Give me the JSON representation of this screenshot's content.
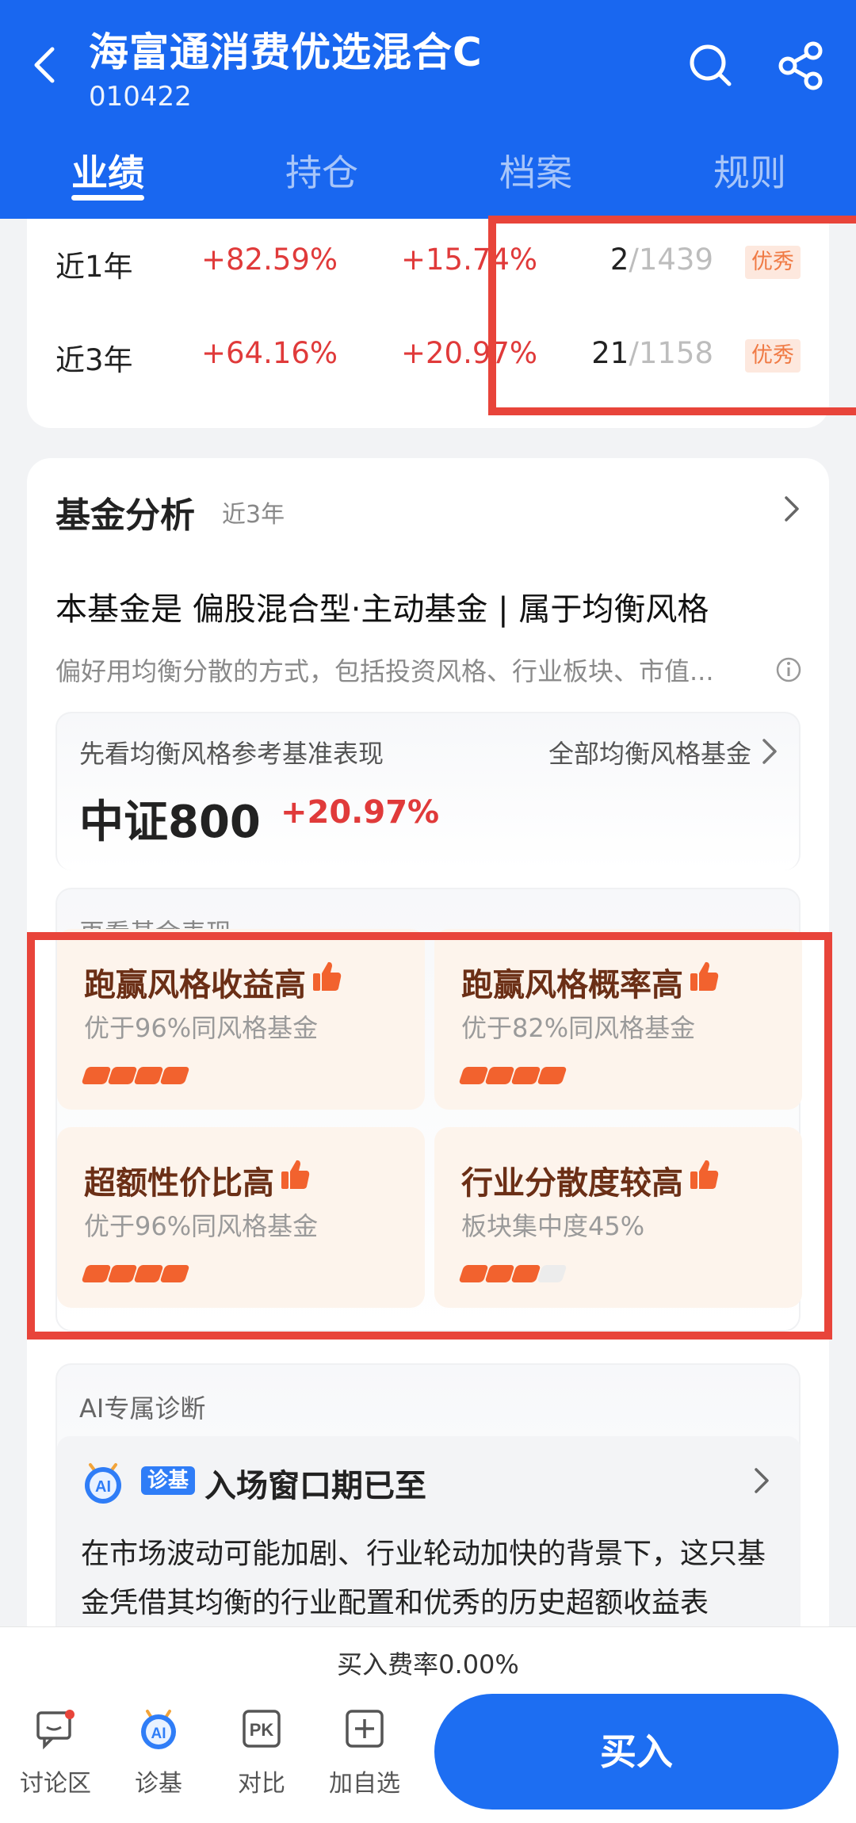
{
  "header": {
    "title": "海富通消费优选混合C",
    "code": "010422",
    "tabs": [
      "业绩",
      "持仓",
      "档案",
      "规则"
    ],
    "active_tab": "业绩"
  },
  "rank_rows": [
    {
      "period": "近1年",
      "fund_return": "+82.59%",
      "benchmark_return": "+15.74%",
      "rank": "2",
      "total": "1439",
      "badge": "优秀"
    },
    {
      "period": "近3年",
      "fund_return": "+64.16%",
      "benchmark_return": "+20.97%",
      "rank": "21",
      "total": "1158",
      "badge": "优秀"
    }
  ],
  "analysis": {
    "title": "基金分析",
    "period": "近3年",
    "headline": "本基金是 偏股混合型·主动基金 | 属于均衡风格",
    "description": "偏好用均衡分散的方式，包括投资风格、行业板块、市值...",
    "benchmark": {
      "label": "先看均衡风格参考基准表现",
      "all_link": "全部均衡风格基金",
      "index_name": "中证800",
      "index_return": "+20.97%"
    },
    "performance": {
      "label": "再看基金表现",
      "tiles": [
        {
          "title": "跑赢风格收益高",
          "subtitle": "优于96%同风格基金",
          "level": 4,
          "max": 4
        },
        {
          "title": "跑赢风格概率高",
          "subtitle": "优于82%同风格基金",
          "level": 4,
          "max": 4
        },
        {
          "title": "超额性价比高",
          "subtitle": "优于96%同风格基金",
          "level": 4,
          "max": 4
        },
        {
          "title": "行业分散度较高",
          "subtitle": "板块集中度45%",
          "level": 3,
          "max": 4
        }
      ]
    },
    "ai": {
      "label": "AI专属诊断",
      "tag": "诊基",
      "title": "入场窗口期已至",
      "text": "在市场波动可能加剧、行业轮动加快的背景下，这只基金凭借其均衡的行业配置和优秀的历史超额收益表"
    }
  },
  "bottom": {
    "fee": "买入费率0.00%",
    "nav": [
      {
        "label": "讨论区",
        "icon": "chat-icon"
      },
      {
        "label": "诊基",
        "icon": "ai-diagnose-icon"
      },
      {
        "label": "对比",
        "icon": "pk-compare-icon"
      },
      {
        "label": "加自选",
        "icon": "add-watchlist-icon"
      }
    ],
    "buy": "买入"
  },
  "colors": {
    "brand_blue": "#1967f0",
    "red": "#e03a3a",
    "orange": "#f2622e",
    "highlight_red": "#e8443a"
  }
}
